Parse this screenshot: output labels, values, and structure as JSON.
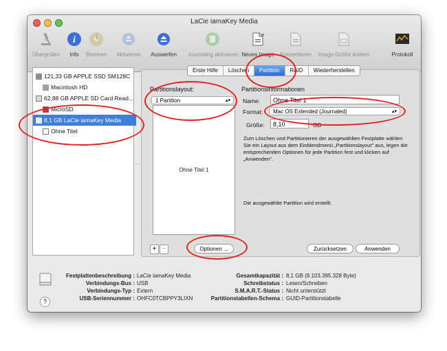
{
  "window": {
    "title": "LaCie iamaKey Media"
  },
  "toolbar": {
    "items": [
      {
        "label": "Überprüfen",
        "icon": "microscope-icon",
        "enabled": false
      },
      {
        "label": "Info",
        "icon": "info-icon",
        "enabled": true
      },
      {
        "label": "Brennen",
        "icon": "burn-disc-icon",
        "enabled": false
      },
      {
        "label": "Aktivieren",
        "icon": "mount-icon",
        "enabled": false
      },
      {
        "label": "Auswerfen",
        "icon": "eject-icon",
        "enabled": true
      },
      {
        "label": "Journaling aktivieren",
        "icon": "journaling-icon",
        "enabled": false
      },
      {
        "label": "Neues Image",
        "icon": "new-image-icon",
        "enabled": true
      },
      {
        "label": "Konvertieren",
        "icon": "convert-icon",
        "enabled": false
      },
      {
        "label": "Image-Größe ändern",
        "icon": "resize-image-icon",
        "enabled": false
      },
      {
        "label": "Protokoll",
        "icon": "log-icon",
        "enabled": true
      }
    ]
  },
  "sidebar": {
    "items": [
      {
        "label": "121,33 GB APPLE SSD SM128C",
        "kind": "disk"
      },
      {
        "label": "Macintosh HD",
        "kind": "volume"
      },
      {
        "label": "62,88 GB APPLE SD Card Read...",
        "kind": "disk"
      },
      {
        "label": "MicroSD",
        "kind": "volume"
      },
      {
        "label": "8,1 GB LaCie iamaKey Media",
        "kind": "disk",
        "selected": true
      },
      {
        "label": "Ohne Titel",
        "kind": "volume"
      }
    ]
  },
  "tabs": [
    "Erste Hilfe",
    "Löschen",
    "Partition",
    "RAID",
    "Wiederherstellen"
  ],
  "active_tab": "Partition",
  "layout": {
    "heading": "Partitionslayout:",
    "selected": "1 Partition",
    "partition_name": "Ohne Titel 1",
    "add_label": "+",
    "remove_label": "−",
    "options_label": "Optionen ..."
  },
  "info": {
    "heading": "Partitionsinformationen",
    "name_label": "Name:",
    "name_value": "Ohne Titel 1",
    "format_label": "Format:",
    "format_value": "Mac OS Extended (Journaled)",
    "size_label": "Größe:",
    "size_value": "8,10",
    "size_unit": "GB",
    "description": "Zum Löschen und Partitionieren der ausgewählten Festplatte wählen Sie ein Layout aus dem Einblendmenü „Partitionslayout\" aus, legen die entsprechenden Optionen für jede Partition fest und klicken auf „Anwenden\".",
    "status": "Die ausgewählte Partition wird erstellt.",
    "revert_label": "Zurücksetzen",
    "apply_label": "Anwenden"
  },
  "footer": {
    "left": [
      {
        "key": "Festplattenbeschreibung :",
        "value": "LaCie iamaKey Media"
      },
      {
        "key": "Verbindungs-Bus :",
        "value": "USB"
      },
      {
        "key": "Verbindungs-Typ :",
        "value": "Extern"
      },
      {
        "key": "USB-Seriennummer :",
        "value": "OHFC0TCBPPY3LIXN"
      }
    ],
    "right": [
      {
        "key": "Gesamtkapazität :",
        "value": "8,1 GB (8.103.395.328 Byte)"
      },
      {
        "key": "Schreibstatus :",
        "value": "Lesen/Schreiben"
      },
      {
        "key": "S.M.A.R.T.-Status :",
        "value": "Nicht unterstützt"
      },
      {
        "key": "Partitionstabellen-Schema :",
        "value": "GUID-Partitionstabelle"
      }
    ],
    "help_label": "?"
  },
  "colors": {
    "annotation": "#e02222",
    "selection": "#3e7fd7"
  }
}
